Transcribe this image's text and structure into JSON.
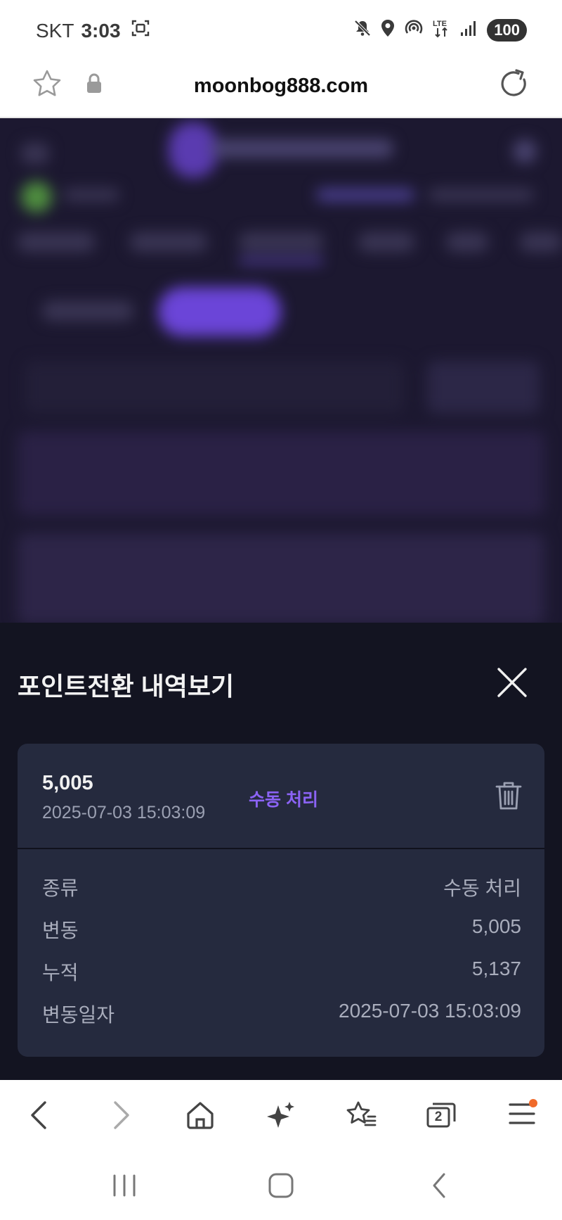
{
  "status_bar": {
    "carrier": "SKT",
    "time": "3:03",
    "battery": "100",
    "network": "LTE"
  },
  "browser": {
    "url": "moonbog888.com",
    "tabs_count": "2"
  },
  "sheet": {
    "title": "포인트전환 내역보기",
    "entry": {
      "amount": "5,005",
      "datetime": "2025-07-03 15:03:09",
      "status": "수동 처리",
      "details": [
        {
          "label": "종류",
          "value": "수동 처리"
        },
        {
          "label": "변동",
          "value": "5,005"
        },
        {
          "label": "누적",
          "value": "5,137"
        },
        {
          "label": "변동일자",
          "value": "2025-07-03 15:03:09"
        }
      ]
    }
  },
  "colors": {
    "sheet_bg": "#131421",
    "card_bg": "#252a3e",
    "accent": "#8b63f5",
    "page_bg": "#1c1830"
  },
  "icons": [
    "mute-icon",
    "location-icon",
    "hotspot-icon",
    "signal-icon",
    "screenshot-icon",
    "star-icon",
    "lock-icon",
    "reload-icon",
    "close-icon",
    "trash-icon",
    "back-icon",
    "forward-icon",
    "home-icon",
    "sparkle-icon",
    "bookmarks-icon",
    "tabs-icon",
    "menu-icon"
  ]
}
